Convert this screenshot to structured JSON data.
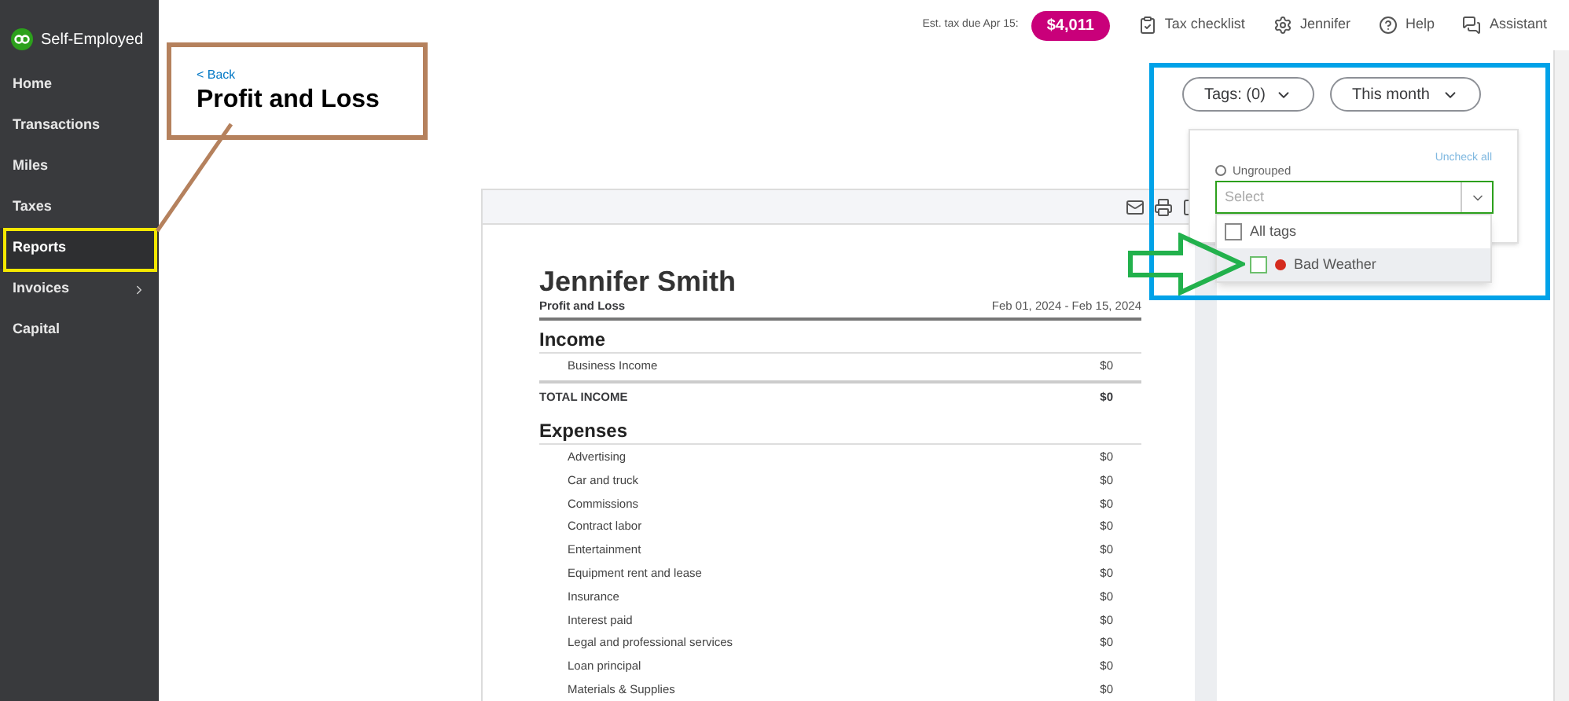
{
  "sidebar": {
    "brand": "Self-Employed",
    "items": [
      {
        "label": "Home",
        "selected": false,
        "has_submenu": false
      },
      {
        "label": "Transactions",
        "selected": false,
        "has_submenu": false
      },
      {
        "label": "Miles",
        "selected": false,
        "has_submenu": false
      },
      {
        "label": "Taxes",
        "selected": false,
        "has_submenu": false
      },
      {
        "label": "Reports",
        "selected": true,
        "has_submenu": false
      },
      {
        "label": "Invoices",
        "selected": false,
        "has_submenu": true
      },
      {
        "label": "Capital",
        "selected": false,
        "has_submenu": false
      }
    ]
  },
  "header": {
    "tax_label": "Est. tax due Apr 15:",
    "tax_amount": "$4,011",
    "links": [
      "Tax checklist",
      "Jennifer",
      "Help",
      "Assistant"
    ]
  },
  "page": {
    "back": "< Back",
    "title": "Profit and Loss"
  },
  "filters": {
    "tags": "Tags: (0)",
    "period": "This month"
  },
  "tag_popup": {
    "uncheck_all": "Uncheck all",
    "ungrouped": {
      "label": "Ungrouped",
      "selected": false
    },
    "select_placeholder": "Select",
    "options": [
      {
        "label": "All tags",
        "checked": false,
        "highlighted": false
      },
      {
        "label": "Bad Weather",
        "checked": false,
        "highlighted": true,
        "color": "#d52b1e"
      }
    ]
  },
  "report": {
    "name": "Jennifer Smith",
    "subtitle": "Profit and Loss",
    "date_range": "Feb 01, 2024 - Feb 15, 2024",
    "sections": [
      {
        "title": "Income",
        "rows": [
          {
            "label": "Business Income",
            "amount": "$0"
          }
        ],
        "total": {
          "label": "TOTAL INCOME",
          "amount": "$0"
        }
      },
      {
        "title": "Expenses",
        "rows": [
          {
            "label": "Advertising",
            "amount": "$0"
          },
          {
            "label": "Car and truck",
            "amount": "$0"
          },
          {
            "label": "Commissions",
            "amount": "$0"
          },
          {
            "label": "Contract labor",
            "amount": "$0"
          },
          {
            "label": "Entertainment",
            "amount": "$0"
          },
          {
            "label": "Equipment rent and lease",
            "amount": "$0"
          },
          {
            "label": "Insurance",
            "amount": "$0"
          },
          {
            "label": "Interest paid",
            "amount": "$0"
          },
          {
            "label": "Legal and professional services",
            "amount": "$0"
          },
          {
            "label": "Loan principal",
            "amount": "$0"
          },
          {
            "label": "Materials & Supplies",
            "amount": "$0"
          }
        ]
      }
    ]
  }
}
